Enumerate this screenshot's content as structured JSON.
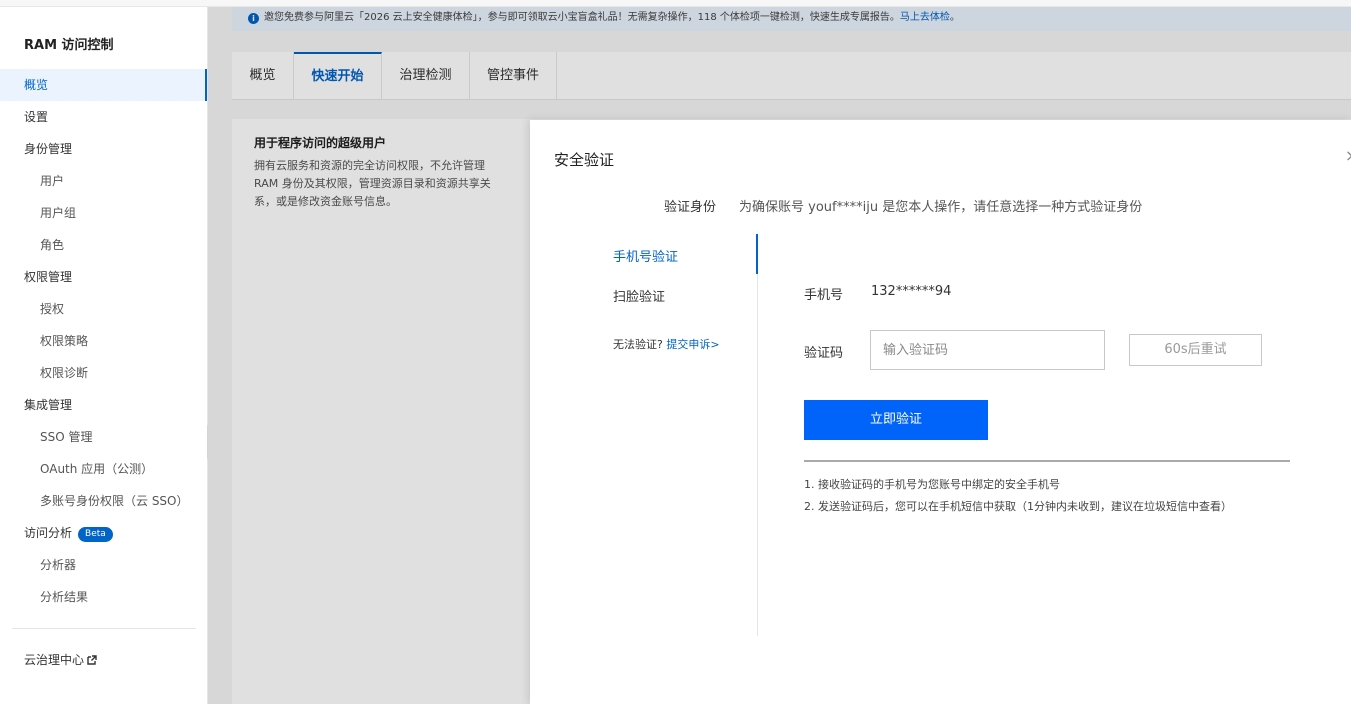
{
  "sidebar": {
    "title": "RAM 访问控制",
    "items": [
      {
        "label": "概览",
        "sub": false,
        "active": true
      },
      {
        "label": "设置",
        "sub": false
      },
      {
        "label": "身份管理",
        "sub": false
      },
      {
        "label": "用户",
        "sub": true
      },
      {
        "label": "用户组",
        "sub": true
      },
      {
        "label": "角色",
        "sub": true
      },
      {
        "label": "权限管理",
        "sub": false
      },
      {
        "label": "授权",
        "sub": true
      },
      {
        "label": "权限策略",
        "sub": true
      },
      {
        "label": "权限诊断",
        "sub": true
      },
      {
        "label": "集成管理",
        "sub": false
      },
      {
        "label": "SSO 管理",
        "sub": true
      },
      {
        "label": "OAuth 应用（公测）",
        "sub": true
      },
      {
        "label": "多账号身份权限（云 SSO）",
        "sub": true
      },
      {
        "label": "访问分析",
        "sub": false,
        "badge": "Beta"
      },
      {
        "label": "分析器",
        "sub": true
      },
      {
        "label": "分析结果",
        "sub": true
      }
    ],
    "footer_link": "云治理中心"
  },
  "banner": {
    "text": "邀您免费参与阿里云「2026 云上安全健康体检」，参与即可领取云小宝盲盒礼品！无需复杂操作，118 个体检项一键检测，快速生成专属报告。",
    "link": "马上去体检",
    "tail": "。"
  },
  "tabs": [
    "概览",
    "快速开始",
    "治理检测",
    "管控事件"
  ],
  "active_tab": "快速开始",
  "card": {
    "title": "用于程序访问的超级用户",
    "desc": "拥有云服务和资源的完全访问权限，不允许管理 RAM 身份及其权限，管理资源目录和资源共享关系，或是修改资金账号信息。"
  },
  "dialog": {
    "title": "安全验证",
    "close": "×",
    "verify_label": "验证身份",
    "verify_text": "为确保账号 youf****iju 是您本人操作，请任意选择一种方式验证身份",
    "methods": [
      "手机号验证",
      "扫脸验证"
    ],
    "cannot_verify": "无法验证?",
    "appeal_link": "提交申诉>",
    "phone_label": "手机号",
    "phone_value": "132******94",
    "code_label": "验证码",
    "code_placeholder": "输入验证码",
    "retry_button": "60s后重试",
    "submit_button": "立即验证",
    "notes": [
      "1. 接收验证码的手机号为您账号中绑定的安全手机号",
      "2. 发送验证码后，您可以在手机短信中获取（1分钟内未收到，建议在垃圾短信中查看）"
    ]
  },
  "colors": {
    "accent": "#0064c8",
    "button": "#0064fa"
  }
}
